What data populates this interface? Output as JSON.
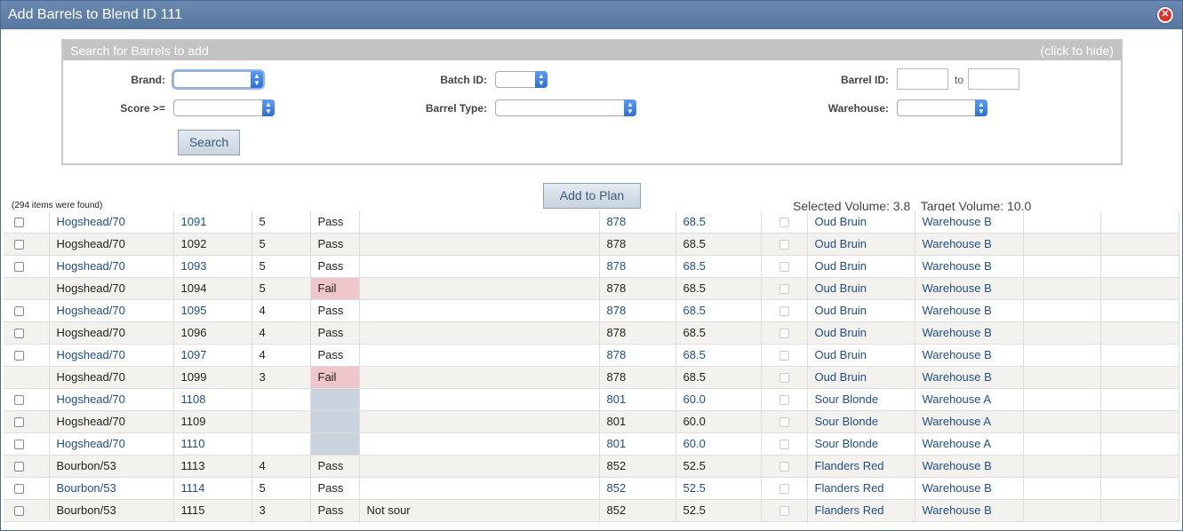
{
  "window": {
    "title": "Add Barrels to Blend ID 111",
    "close_icon": "close-icon"
  },
  "search": {
    "header": "Search for Barrels to add",
    "toggle": "(click to hide)",
    "labels": {
      "brand": "Brand:",
      "score": "Score >=",
      "batch_id": "Batch ID:",
      "barrel_type": "Barrel Type:",
      "barrel_id": "Barrel ID:",
      "to": "to",
      "warehouse": "Warehouse:"
    },
    "search_button": "Search"
  },
  "results": {
    "found_text": "(294 items were found)",
    "add_button": "Add to Plan",
    "selected_volume_label": "Selected Volume:",
    "selected_volume": "3.8",
    "target_volume_label": "Target Volume:",
    "target_volume": "10.0"
  },
  "rows": [
    {
      "check": true,
      "type": "Hogshead/70",
      "id": "1091",
      "score": "5",
      "status": "Pass",
      "note": "",
      "batch": "878",
      "vol": "68.5",
      "brand": "Oud Bruin",
      "wh": "Warehouse B",
      "linked": true
    },
    {
      "check": true,
      "type": "Hogshead/70",
      "id": "1092",
      "score": "5",
      "status": "Pass",
      "note": "",
      "batch": "878",
      "vol": "68.5",
      "brand": "Oud Bruin",
      "wh": "Warehouse B",
      "linked": false
    },
    {
      "check": true,
      "type": "Hogshead/70",
      "id": "1093",
      "score": "5",
      "status": "Pass",
      "note": "",
      "batch": "878",
      "vol": "68.5",
      "brand": "Oud Bruin",
      "wh": "Warehouse B",
      "linked": true
    },
    {
      "check": false,
      "type": "Hogshead/70",
      "id": "1094",
      "score": "5",
      "status": "Fail",
      "note": "",
      "batch": "878",
      "vol": "68.5",
      "brand": "Oud Bruin",
      "wh": "Warehouse B",
      "linked": false
    },
    {
      "check": true,
      "type": "Hogshead/70",
      "id": "1095",
      "score": "4",
      "status": "Pass",
      "note": "",
      "batch": "878",
      "vol": "68.5",
      "brand": "Oud Bruin",
      "wh": "Warehouse B",
      "linked": true
    },
    {
      "check": true,
      "type": "Hogshead/70",
      "id": "1096",
      "score": "4",
      "status": "Pass",
      "note": "",
      "batch": "878",
      "vol": "68.5",
      "brand": "Oud Bruin",
      "wh": "Warehouse B",
      "linked": false
    },
    {
      "check": true,
      "type": "Hogshead/70",
      "id": "1097",
      "score": "4",
      "status": "Pass",
      "note": "",
      "batch": "878",
      "vol": "68.5",
      "brand": "Oud Bruin",
      "wh": "Warehouse B",
      "linked": true
    },
    {
      "check": false,
      "type": "Hogshead/70",
      "id": "1099",
      "score": "3",
      "status": "Fail",
      "note": "",
      "batch": "878",
      "vol": "68.5",
      "brand": "Oud Bruin",
      "wh": "Warehouse B",
      "linked": false
    },
    {
      "check": true,
      "type": "Hogshead/70",
      "id": "1108",
      "score": "",
      "status": "",
      "note": "",
      "batch": "801",
      "vol": "60.0",
      "brand": "Sour Blonde",
      "wh": "Warehouse A",
      "linked": true
    },
    {
      "check": true,
      "type": "Hogshead/70",
      "id": "1109",
      "score": "",
      "status": "",
      "note": "",
      "batch": "801",
      "vol": "60.0",
      "brand": "Sour Blonde",
      "wh": "Warehouse A",
      "linked": false
    },
    {
      "check": true,
      "type": "Hogshead/70",
      "id": "1110",
      "score": "",
      "status": "",
      "note": "",
      "batch": "801",
      "vol": "60.0",
      "brand": "Sour Blonde",
      "wh": "Warehouse A",
      "linked": true
    },
    {
      "check": true,
      "type": "Bourbon/53",
      "id": "1113",
      "score": "4",
      "status": "Pass",
      "note": "",
      "batch": "852",
      "vol": "52.5",
      "brand": "Flanders Red",
      "wh": "Warehouse B",
      "linked": false
    },
    {
      "check": true,
      "type": "Bourbon/53",
      "id": "1114",
      "score": "5",
      "status": "Pass",
      "note": "",
      "batch": "852",
      "vol": "52.5",
      "brand": "Flanders Red",
      "wh": "Warehouse B",
      "linked": true
    },
    {
      "check": true,
      "type": "Bourbon/53",
      "id": "1115",
      "score": "3",
      "status": "Pass",
      "note": "Not sour",
      "batch": "852",
      "vol": "52.5",
      "brand": "Flanders Red",
      "wh": "Warehouse B",
      "linked": false
    }
  ]
}
